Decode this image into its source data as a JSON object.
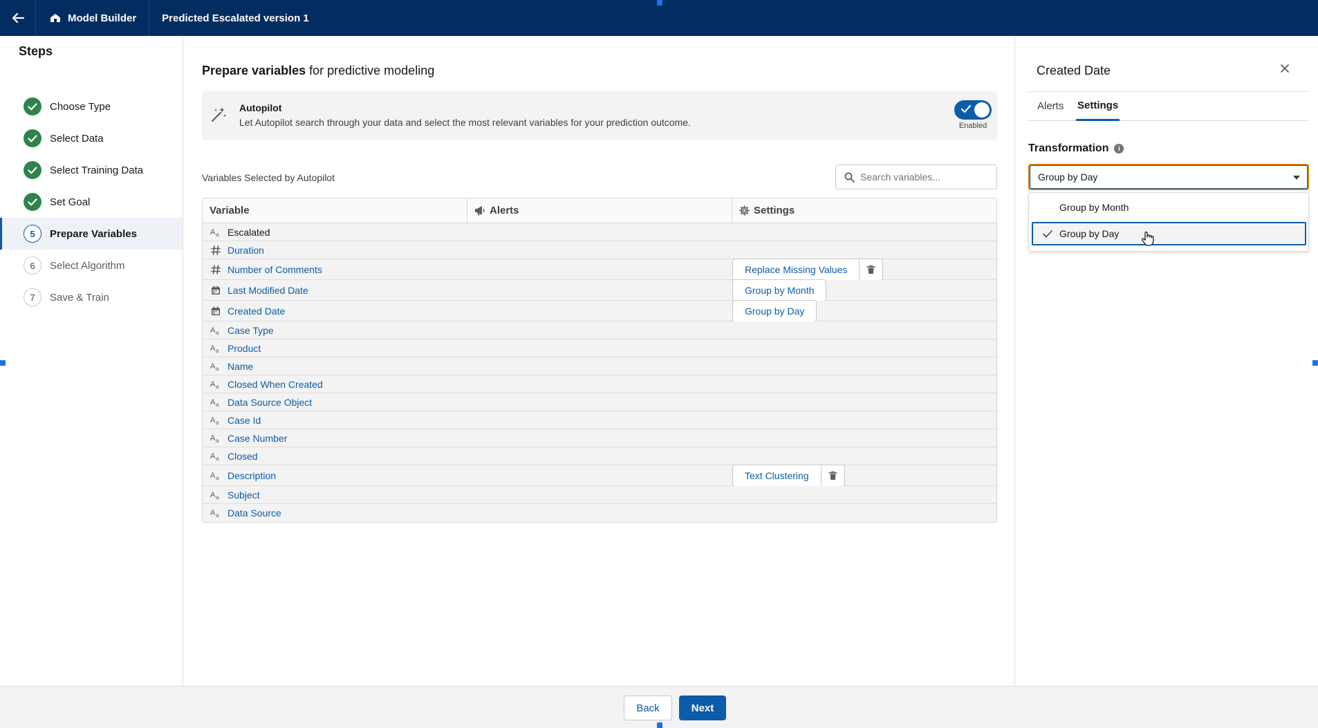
{
  "header": {
    "app_name": "Model Builder",
    "model_title": "Predicted Escalated version 1"
  },
  "steps": {
    "title": "Steps",
    "items": [
      {
        "label": "Choose Type",
        "status": "complete"
      },
      {
        "label": "Select Data",
        "status": "complete"
      },
      {
        "label": "Select Training Data",
        "status": "complete"
      },
      {
        "label": "Set Goal",
        "status": "complete"
      },
      {
        "label": "Prepare Variables",
        "status": "active",
        "number": "5"
      },
      {
        "label": "Select Algorithm",
        "status": "upcoming",
        "number": "6"
      },
      {
        "label": "Save & Train",
        "status": "upcoming",
        "number": "7"
      }
    ]
  },
  "main": {
    "heading_bold": "Prepare variables",
    "heading_rest": "for predictive modeling",
    "autopilot": {
      "title": "Autopilot",
      "description": "Let Autopilot search through your data and select the most relevant variables for your prediction outcome.",
      "toggle_label": "Enabled"
    },
    "vars_label": "Variables Selected by Autopilot",
    "search_placeholder": "Search variables...",
    "table": {
      "columns": [
        "Variable",
        "Alerts",
        "Settings"
      ],
      "rows": [
        {
          "type": "text",
          "name": "Escalated",
          "target": true
        },
        {
          "type": "number",
          "name": "Duration"
        },
        {
          "type": "number",
          "name": "Number of Comments",
          "setting": "Replace Missing Values",
          "trash": true
        },
        {
          "type": "date",
          "name": "Last Modified Date",
          "setting": "Group by Month"
        },
        {
          "type": "date",
          "name": "Created Date",
          "setting": "Group by Day"
        },
        {
          "type": "text",
          "name": "Case Type"
        },
        {
          "type": "text",
          "name": "Product"
        },
        {
          "type": "text",
          "name": "Name"
        },
        {
          "type": "text",
          "name": "Closed When Created"
        },
        {
          "type": "text",
          "name": "Data Source Object"
        },
        {
          "type": "text",
          "name": "Case Id"
        },
        {
          "type": "text",
          "name": "Case Number"
        },
        {
          "type": "text",
          "name": "Closed"
        },
        {
          "type": "text",
          "name": "Description",
          "setting": "Text Clustering",
          "trash": true
        },
        {
          "type": "text",
          "name": "Subject"
        },
        {
          "type": "text",
          "name": "Data Source"
        }
      ]
    }
  },
  "panel": {
    "title": "Created Date",
    "tabs": [
      "Alerts",
      "Settings"
    ],
    "active_tab": "Settings",
    "transformation_label": "Transformation",
    "selected_value": "Group by Day",
    "options": [
      "Group by Month",
      "Group by Day"
    ]
  },
  "footer": {
    "back_label": "Back",
    "next_label": "Next"
  },
  "colors": {
    "header_bg": "#032d60",
    "brand_blue": "#0b5cab",
    "success_green": "#2e844a",
    "focus_orange": "#dd7a01"
  }
}
